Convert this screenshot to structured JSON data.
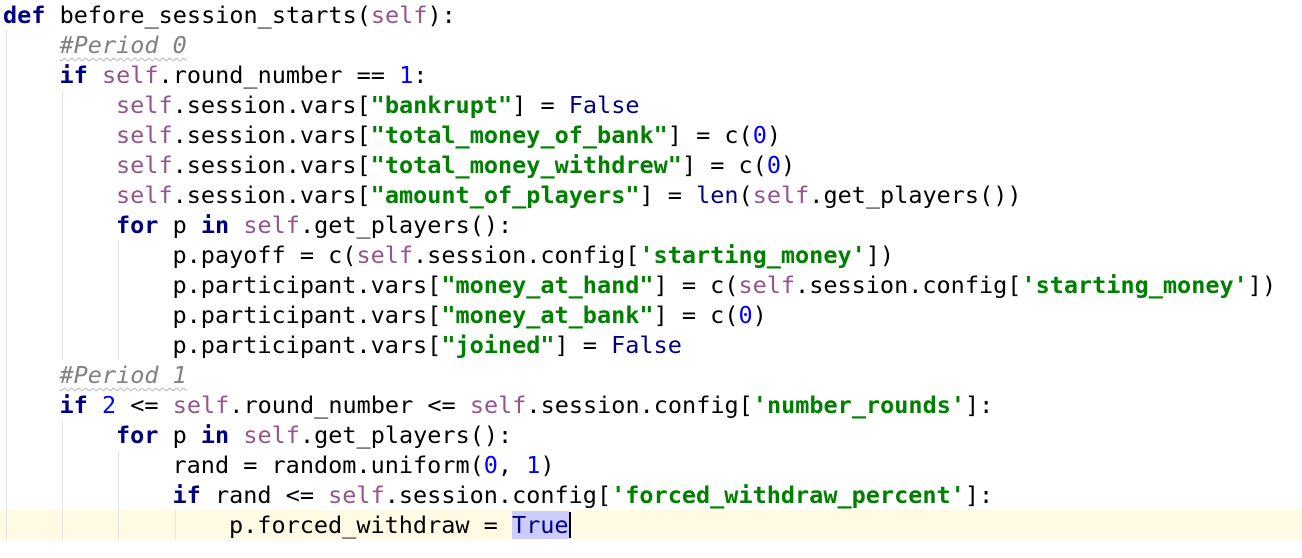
{
  "editor": {
    "language": "python",
    "current_line_index": 17,
    "lines": [
      {
        "indent": 0,
        "tokens": [
          [
            "kw",
            "def"
          ],
          [
            "plain",
            " before_session_starts("
          ],
          [
            "self",
            "self"
          ],
          [
            "plain",
            "):"
          ]
        ]
      },
      {
        "indent": 1,
        "tokens": [
          [
            "comment",
            "#Period 0"
          ]
        ]
      },
      {
        "indent": 1,
        "tokens": [
          [
            "kw",
            "if"
          ],
          [
            "plain",
            " "
          ],
          [
            "self",
            "self"
          ],
          [
            "plain",
            ".round_number == "
          ],
          [
            "num",
            "1"
          ],
          [
            "plain",
            ":"
          ]
        ]
      },
      {
        "indent": 2,
        "tokens": [
          [
            "self",
            "self"
          ],
          [
            "plain",
            ".session.vars["
          ],
          [
            "str",
            "\"bankrupt\""
          ],
          [
            "plain",
            "] = "
          ],
          [
            "builtin",
            "False"
          ]
        ]
      },
      {
        "indent": 2,
        "tokens": [
          [
            "self",
            "self"
          ],
          [
            "plain",
            ".session.vars["
          ],
          [
            "str",
            "\"total_money_of_bank\""
          ],
          [
            "plain",
            "] = c("
          ],
          [
            "num",
            "0"
          ],
          [
            "plain",
            ")"
          ]
        ]
      },
      {
        "indent": 2,
        "tokens": [
          [
            "self",
            "self"
          ],
          [
            "plain",
            ".session.vars["
          ],
          [
            "str",
            "\"total_money_withdrew\""
          ],
          [
            "plain",
            "] = c("
          ],
          [
            "num",
            "0"
          ],
          [
            "plain",
            ")"
          ]
        ]
      },
      {
        "indent": 2,
        "tokens": [
          [
            "self",
            "self"
          ],
          [
            "plain",
            ".session.vars["
          ],
          [
            "str",
            "\"amount_of_players\""
          ],
          [
            "plain",
            "] = "
          ],
          [
            "builtin",
            "len"
          ],
          [
            "plain",
            "("
          ],
          [
            "self",
            "self"
          ],
          [
            "plain",
            ".get_players())"
          ]
        ]
      },
      {
        "indent": 2,
        "tokens": [
          [
            "kw",
            "for"
          ],
          [
            "plain",
            " p "
          ],
          [
            "kw",
            "in"
          ],
          [
            "plain",
            " "
          ],
          [
            "self",
            "self"
          ],
          [
            "plain",
            ".get_players():"
          ]
        ]
      },
      {
        "indent": 3,
        "tokens": [
          [
            "plain",
            "p.payoff = c("
          ],
          [
            "self",
            "self"
          ],
          [
            "plain",
            ".session.config["
          ],
          [
            "str",
            "'starting_money'"
          ],
          [
            "plain",
            "])"
          ]
        ]
      },
      {
        "indent": 3,
        "tokens": [
          [
            "plain",
            "p.participant.vars["
          ],
          [
            "str",
            "\"money_at_hand\""
          ],
          [
            "plain",
            "] = c("
          ],
          [
            "self",
            "self"
          ],
          [
            "plain",
            ".session.config["
          ],
          [
            "str",
            "'starting_money'"
          ],
          [
            "plain",
            "])"
          ]
        ]
      },
      {
        "indent": 3,
        "tokens": [
          [
            "plain",
            "p.participant.vars["
          ],
          [
            "str",
            "\"money_at_bank\""
          ],
          [
            "plain",
            "] = c("
          ],
          [
            "num",
            "0"
          ],
          [
            "plain",
            ")"
          ]
        ]
      },
      {
        "indent": 3,
        "tokens": [
          [
            "plain",
            "p.participant.vars["
          ],
          [
            "str",
            "\"joined\""
          ],
          [
            "plain",
            "] = "
          ],
          [
            "builtin",
            "False"
          ]
        ]
      },
      {
        "indent": 1,
        "tokens": [
          [
            "comment",
            "#Period 1"
          ]
        ]
      },
      {
        "indent": 1,
        "tokens": [
          [
            "kw",
            "if"
          ],
          [
            "plain",
            " "
          ],
          [
            "num",
            "2"
          ],
          [
            "plain",
            " <= "
          ],
          [
            "self",
            "self"
          ],
          [
            "plain",
            ".round_number <= "
          ],
          [
            "self",
            "self"
          ],
          [
            "plain",
            ".session.config["
          ],
          [
            "str",
            "'number_rounds'"
          ],
          [
            "plain",
            "]:"
          ]
        ]
      },
      {
        "indent": 2,
        "tokens": [
          [
            "kw",
            "for"
          ],
          [
            "plain",
            " p "
          ],
          [
            "kw",
            "in"
          ],
          [
            "plain",
            " "
          ],
          [
            "self",
            "self"
          ],
          [
            "plain",
            ".get_players():"
          ]
        ]
      },
      {
        "indent": 3,
        "tokens": [
          [
            "plain",
            "rand = random.uniform("
          ],
          [
            "num",
            "0"
          ],
          [
            "plain",
            ", "
          ],
          [
            "num",
            "1"
          ],
          [
            "plain",
            ")"
          ]
        ]
      },
      {
        "indent": 3,
        "tokens": [
          [
            "kw",
            "if"
          ],
          [
            "plain",
            " rand <= "
          ],
          [
            "self",
            "self"
          ],
          [
            "plain",
            ".session.config["
          ],
          [
            "str",
            "'forced_withdraw_percent'"
          ],
          [
            "plain",
            "]:"
          ]
        ]
      },
      {
        "indent": 4,
        "tokens": [
          [
            "plain",
            "p.forced_withdraw = "
          ],
          [
            "builtin-hl",
            "True"
          ],
          [
            "caret",
            ""
          ]
        ]
      }
    ]
  }
}
